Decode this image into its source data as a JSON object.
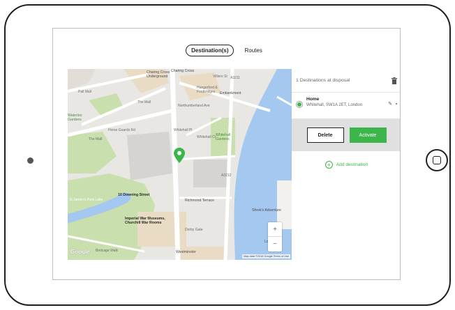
{
  "tabs": {
    "destinations": "Destination(s)",
    "routes": "Routes"
  },
  "panel": {
    "count_label": "1 Destinations at disposal",
    "destination": {
      "name": "Home",
      "address": "Whitehall, SW1A 2ET, London"
    },
    "delete_label": "Delete",
    "activate_label": "Activate",
    "add_label": "Add destination"
  },
  "map": {
    "labels": {
      "charing_cross": "Charing Cross",
      "charing_cross_underground": "Charing Cross\nUnderground",
      "charing_cross_top": "Charing Cross",
      "villiers": "Villiers St",
      "hungerford": "Hungerford &\nFootbridges",
      "embankment": "Embankment",
      "pall_mall": "Pall Mall",
      "the_mall": "The Mall",
      "northumberland": "Northumberland Ave",
      "waterloo_gardens": "Waterloo\nGardens",
      "the_mall_2": "The Mall",
      "horse_guards": "Horse Guards Rd",
      "whitehall_pl": "Whitehall Pl",
      "whitehall_ct": "Whitehall Ct",
      "whitehall_gardens": "Whitehall\nGardens",
      "a3211": "A3211",
      "a3212": "A3212",
      "st_james_park_lake": "St James's Park Lake",
      "downing_street": "10 Downing Street",
      "richmond_terrace": "Richmond Terrace",
      "imperial_war": "Imperial War Museums,\nChurchill War Rooms",
      "derby_gate": "Derby Gate",
      "shreks": "Shrek's Adventure",
      "london_aq": "London Aq",
      "storeys_gate": "Birdcage Walk",
      "westminster": "Westminster"
    },
    "google": "Google",
    "footer": "Map data ©2016 Google   Terms of Use",
    "zoom_in": "+",
    "zoom_out": "−"
  },
  "colors": {
    "accent": "#3cb54a",
    "water": "#a4c8f0",
    "park": "#c9dfae"
  }
}
